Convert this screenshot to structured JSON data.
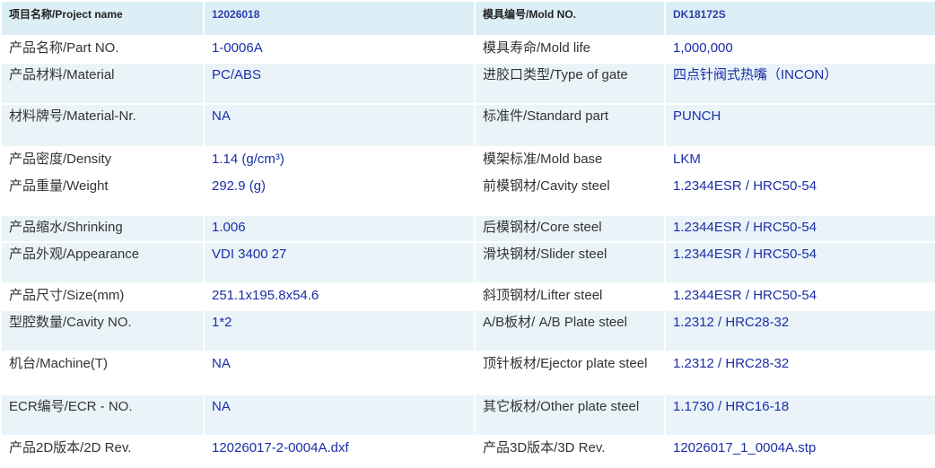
{
  "header": {
    "project_label": "项目名称/Project name",
    "project_value": "12026018",
    "mold_label": "模具编号/Mold NO.",
    "mold_value": "DK18172S"
  },
  "rows": [
    {
      "l1": "产品名称/Part NO.",
      "v1": "1-0006A",
      "l2": "模具寿命/Mold life",
      "v2": "1,000,000"
    },
    {
      "l1": "产品材料/Material",
      "v1": "PC/ABS",
      "l2": "进胶口类型/Type of gate",
      "v2": "四点针阀式热嘴（INCON）"
    },
    {
      "l1": "材料牌号/Material-Nr.",
      "v1": "NA",
      "l2": "标准件/Standard part",
      "v2": "PUNCH"
    },
    {
      "l1": "产品密度/Density",
      "v1": "1.14 (g/cm³)",
      "l2": "模架标准/Mold base",
      "v2": "LKM"
    },
    {
      "l1": "产品重量/Weight",
      "v1": "292.9 (g)",
      "l2": "前模钢材/Cavity steel",
      "v2": "1.2344ESR / HRC50-54"
    },
    {
      "l1": "产品缩水/Shrinking",
      "v1": "1.006",
      "l2": "后模钢材/Core steel",
      "v2": "1.2344ESR / HRC50-54"
    },
    {
      "l1": "产品外观/Appearance",
      "v1": "VDI 3400  27",
      "l2": "滑块钢材/Slider steel",
      "v2": "1.2344ESR / HRC50-54"
    },
    {
      "l1": "产品尺寸/Size(mm)",
      "v1": "251.1x195.8x54.6",
      "l2": "斜顶钢材/Lifter steel",
      "v2": "1.2344ESR / HRC50-54"
    },
    {
      "l1": "型腔数量/Cavity NO.",
      "v1": "1*2",
      "l2": "A/B板材/ A/B Plate steel",
      "v2": "1.2312 / HRC28-32"
    },
    {
      "l1": "机台/Machine(T)",
      "v1": "NA",
      "l2": "顶针板材/Ejector plate steel",
      "v2": "1.2312 / HRC28-32"
    },
    {
      "l1": "ECR编号/ECR - NO.",
      "v1": "NA",
      "l2": "其它板材/Other plate steel",
      "v2": "1.1730 / HRC16-18"
    },
    {
      "l1": "产品2D版本/2D Rev.",
      "v1": "12026017-2-0004A.dxf",
      "l2": "产品3D版本/3D Rev.",
      "v2": "12026017_1_0004A.stp"
    }
  ]
}
